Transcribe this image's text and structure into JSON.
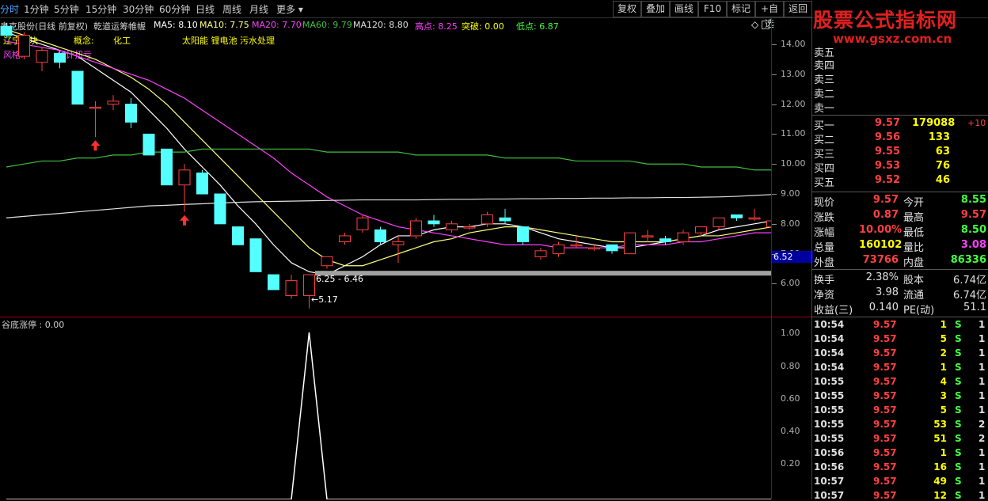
{
  "toolbar": {
    "periods": [
      "分时",
      "1分钟",
      "5分钟",
      "15分钟",
      "30分钟",
      "60分钟",
      "日线",
      "周线",
      "月线",
      "更多"
    ],
    "active_period": "分时",
    "right_buttons": [
      "复权",
      "叠加",
      "画线",
      "F10",
      "标记",
      "+自选",
      "返回"
    ]
  },
  "watermark": {
    "title": "股票公式指标网",
    "url": "www.gsxz.com.cn"
  },
  "chart_header": {
    "stock": "奥克股份(日线 前复权)",
    "indicator": "乾道运筹帷幄",
    "ma5": "MA5: 8.10",
    "ma10": "MA10: 7.75",
    "ma20": "MA20: 7.70",
    "ma60": "MA60: 9.79",
    "ma120": "MA120: 8.80",
    "high": "高点: 8.25",
    "breakout": "突破: 0.00",
    "low": "低点: 6.87"
  },
  "tags": {
    "region": "辽宁板块",
    "concept_label": "概念:",
    "concept_value": "化工",
    "themes": "太阳能 锂电池 污水处理",
    "style_label": "风格:",
    "style_value": "预计扭亏"
  },
  "price_axis": [
    "14.00",
    "13.00",
    "12.00",
    "11.00",
    "10.00",
    "9.00",
    "8.00",
    "7.00",
    "6.00"
  ],
  "current_price_tag": "6.52",
  "annotations": {
    "range": "6.25 - 6.46",
    "low_mark": "5.17"
  },
  "sub_chart": {
    "title": "谷底涨停 : 0.00",
    "axis": [
      "1.00",
      "0.80",
      "0.60",
      "0.40",
      "0.20"
    ]
  },
  "chart_data": {
    "type": "candlestick",
    "candles": [
      {
        "o": 14.6,
        "c": 14.3,
        "h": 14.7,
        "l": 14.2
      },
      {
        "o": 13.6,
        "c": 14.3,
        "h": 14.4,
        "l": 13.5
      },
      {
        "o": 13.4,
        "c": 13.8,
        "h": 13.9,
        "l": 13.1
      },
      {
        "o": 13.7,
        "c": 13.4,
        "h": 13.8,
        "l": 13.2
      },
      {
        "o": 13.1,
        "c": 12.0,
        "h": 13.1,
        "l": 12.0
      },
      {
        "o": 11.9,
        "c": 11.9,
        "h": 12.1,
        "l": 10.9
      },
      {
        "o": 12.0,
        "c": 12.1,
        "h": 12.3,
        "l": 11.8
      },
      {
        "o": 12.0,
        "c": 11.4,
        "h": 12.2,
        "l": 11.2
      },
      {
        "o": 11.0,
        "c": 10.3,
        "h": 11.0,
        "l": 10.3
      },
      {
        "o": 10.5,
        "c": 9.3,
        "h": 10.5,
        "l": 9.3
      },
      {
        "o": 9.3,
        "c": 9.8,
        "h": 10.0,
        "l": 8.4
      },
      {
        "o": 9.7,
        "c": 9.0,
        "h": 9.8,
        "l": 9.0
      },
      {
        "o": 9.0,
        "c": 8.0,
        "h": 9.0,
        "l": 8.0
      },
      {
        "o": 7.9,
        "c": 7.3,
        "h": 7.9,
        "l": 7.3
      },
      {
        "o": 7.5,
        "c": 6.4,
        "h": 7.5,
        "l": 6.4
      },
      {
        "o": 6.3,
        "c": 5.8,
        "h": 6.3,
        "l": 5.8
      },
      {
        "o": 5.6,
        "c": 6.1,
        "h": 6.3,
        "l": 5.5
      },
      {
        "o": 5.6,
        "c": 6.3,
        "h": 6.3,
        "l": 5.17
      },
      {
        "o": 6.6,
        "c": 6.9,
        "h": 6.9,
        "l": 6.5
      },
      {
        "o": 7.4,
        "c": 7.6,
        "h": 7.7,
        "l": 7.3
      },
      {
        "o": 7.8,
        "c": 8.2,
        "h": 8.3,
        "l": 7.7
      },
      {
        "o": 7.8,
        "c": 7.4,
        "h": 7.9,
        "l": 7.3
      },
      {
        "o": 7.3,
        "c": 7.4,
        "h": 7.6,
        "l": 6.7
      },
      {
        "o": 7.6,
        "c": 8.1,
        "h": 8.2,
        "l": 7.5
      },
      {
        "o": 8.1,
        "c": 8.0,
        "h": 8.3,
        "l": 7.9
      },
      {
        "o": 7.8,
        "c": 8.0,
        "h": 8.1,
        "l": 7.7
      },
      {
        "o": 7.9,
        "c": 7.9,
        "h": 8.0,
        "l": 7.8
      },
      {
        "o": 8.0,
        "c": 8.3,
        "h": 8.4,
        "l": 7.9
      },
      {
        "o": 8.2,
        "c": 8.1,
        "h": 8.5,
        "l": 8.0
      },
      {
        "o": 7.9,
        "c": 7.4,
        "h": 7.9,
        "l": 7.3
      },
      {
        "o": 6.9,
        "c": 7.1,
        "h": 7.2,
        "l": 6.8
      },
      {
        "o": 7.0,
        "c": 7.3,
        "h": 7.4,
        "l": 6.9
      },
      {
        "o": 7.3,
        "c": 7.3,
        "h": 7.6,
        "l": 7.2
      },
      {
        "o": 7.2,
        "c": 7.2,
        "h": 7.3,
        "l": 7.1
      },
      {
        "o": 7.3,
        "c": 7.1,
        "h": 7.3,
        "l": 7.0
      },
      {
        "o": 7.0,
        "c": 7.7,
        "h": 7.7,
        "l": 7.0
      },
      {
        "o": 7.6,
        "c": 7.6,
        "h": 7.8,
        "l": 7.4
      },
      {
        "o": 7.5,
        "c": 7.4,
        "h": 7.6,
        "l": 7.3
      },
      {
        "o": 7.4,
        "c": 7.7,
        "h": 7.8,
        "l": 7.3
      },
      {
        "o": 7.7,
        "c": 7.9,
        "h": 7.9,
        "l": 7.6
      },
      {
        "o": 7.9,
        "c": 8.2,
        "h": 8.2,
        "l": 7.8
      },
      {
        "o": 8.3,
        "c": 8.2,
        "h": 8.3,
        "l": 8.1
      },
      {
        "o": 8.2,
        "c": 8.2,
        "h": 8.5,
        "l": 8.1
      },
      {
        "o": 7.9,
        "c": 8.1,
        "h": 8.2,
        "l": 7.9
      }
    ],
    "ma_series": [
      {
        "name": "MA5",
        "color": "#ffffff",
        "values": [
          14.4,
          14.2,
          14.0,
          13.8,
          13.6,
          13.2,
          12.8,
          12.4,
          11.8,
          11.2,
          10.5,
          9.9,
          9.3,
          8.6,
          8.0,
          7.3,
          6.7,
          6.4,
          6.3,
          6.6,
          6.9,
          7.3,
          7.6,
          7.6,
          7.8,
          7.9,
          7.9,
          8.0,
          8.0,
          7.9,
          7.7,
          7.5,
          7.4,
          7.3,
          7.2,
          7.2,
          7.3,
          7.4,
          7.5,
          7.6,
          7.8,
          7.9,
          8.0,
          8.1
        ]
      },
      {
        "name": "MA10",
        "color": "#ffff80",
        "values": [
          14.5,
          14.3,
          14.1,
          13.9,
          13.7,
          13.5,
          13.2,
          12.9,
          12.5,
          12.0,
          11.4,
          10.8,
          10.2,
          9.6,
          9.0,
          8.4,
          7.8,
          7.2,
          6.8,
          6.6,
          6.6,
          6.8,
          7.0,
          7.2,
          7.4,
          7.5,
          7.7,
          7.8,
          7.9,
          7.9,
          7.8,
          7.7,
          7.6,
          7.5,
          7.4,
          7.4,
          7.4,
          7.4,
          7.5,
          7.6,
          7.6,
          7.7,
          7.8,
          7.9
        ]
      },
      {
        "name": "MA20",
        "color": "#ff40ff",
        "values": [
          14.1,
          14.0,
          13.9,
          13.8,
          13.6,
          13.4,
          13.2,
          13.0,
          12.8,
          12.5,
          12.2,
          11.8,
          11.4,
          11.0,
          10.6,
          10.2,
          9.7,
          9.3,
          8.9,
          8.6,
          8.3,
          8.1,
          7.9,
          7.8,
          7.7,
          7.6,
          7.5,
          7.4,
          7.3,
          7.3,
          7.3,
          7.2,
          7.2,
          7.2,
          7.2,
          7.3,
          7.3,
          7.3,
          7.4,
          7.4,
          7.5,
          7.6,
          7.7,
          7.7
        ]
      },
      {
        "name": "MA60",
        "color": "#40c040",
        "values": [
          9.9,
          10.0,
          10.1,
          10.1,
          10.2,
          10.2,
          10.3,
          10.3,
          10.4,
          10.4,
          10.4,
          10.5,
          10.5,
          10.5,
          10.5,
          10.5,
          10.5,
          10.5,
          10.4,
          10.4,
          10.4,
          10.4,
          10.4,
          10.3,
          10.3,
          10.3,
          10.3,
          10.3,
          10.2,
          10.2,
          10.2,
          10.2,
          10.1,
          10.1,
          10.1,
          10.1,
          10.0,
          10.0,
          10.0,
          9.9,
          9.9,
          9.9,
          9.8,
          9.8
        ]
      },
      {
        "name": "MA120",
        "color": "#e0e0e0",
        "values": [
          8.2,
          8.25,
          8.3,
          8.35,
          8.4,
          8.45,
          8.5,
          8.55,
          8.6,
          8.62,
          8.65,
          8.67,
          8.7,
          8.72,
          8.74,
          8.75,
          8.76,
          8.77,
          8.78,
          8.79,
          8.8,
          8.8,
          8.8,
          8.8,
          8.81,
          8.82,
          8.82,
          8.83,
          8.83,
          8.84,
          8.84,
          8.85,
          8.85,
          8.86,
          8.86,
          8.87,
          8.87,
          8.88,
          8.88,
          8.89,
          8.9,
          8.92,
          8.95,
          8.98
        ]
      }
    ],
    "ylim": [
      4.9,
      14.9
    ],
    "sub_series": {
      "values": [
        0,
        0,
        0,
        0,
        0,
        0,
        0,
        0,
        0,
        0,
        0,
        0,
        0,
        0,
        0,
        0,
        0,
        1,
        0,
        0,
        0,
        0,
        0,
        0,
        0,
        0,
        0,
        0,
        0,
        0,
        0,
        0,
        0,
        0,
        0,
        0,
        0,
        0,
        0,
        0,
        0,
        0,
        0,
        0
      ],
      "ylim": [
        0,
        1
      ]
    }
  },
  "quote": {
    "sell_labels": [
      "卖五",
      "卖四",
      "卖三",
      "卖二",
      "卖一"
    ],
    "buy": [
      {
        "label": "买一",
        "price": "9.57",
        "vol": "179088",
        "chg": "+10"
      },
      {
        "label": "买二",
        "price": "9.56",
        "vol": "133",
        "chg": ""
      },
      {
        "label": "买三",
        "price": "9.55",
        "vol": "63",
        "chg": ""
      },
      {
        "label": "买四",
        "price": "9.53",
        "vol": "76",
        "chg": ""
      },
      {
        "label": "买五",
        "price": "9.52",
        "vol": "46",
        "chg": ""
      }
    ],
    "stats": [
      {
        "l1": "现价",
        "v1": "9.57",
        "c1": "#ff4040",
        "l2": "今开",
        "v2": "8.55",
        "c2": "#40ff40"
      },
      {
        "l1": "涨跌",
        "v1": "0.87",
        "c1": "#ff4040",
        "l2": "最高",
        "v2": "9.57",
        "c2": "#ff4040"
      },
      {
        "l1": "涨幅",
        "v1": "10.00%",
        "c1": "#ff4040",
        "l2": "最低",
        "v2": "8.50",
        "c2": "#40ff40"
      },
      {
        "l1": "总量",
        "v1": "160102",
        "c1": "#ffff00",
        "l2": "量比",
        "v2": "3.08",
        "c2": "#ff40ff"
      },
      {
        "l1": "外盘",
        "v1": "73766",
        "c1": "#ff4040",
        "l2": "内盘",
        "v2": "86336",
        "c2": "#40ff40"
      }
    ],
    "fundamentals": [
      {
        "l1": "换手",
        "v1": "2.38%",
        "l2": "股本",
        "v2": "6.74亿"
      },
      {
        "l1": "净资",
        "v1": "3.98",
        "l2": "流通",
        "v2": "6.74亿"
      },
      {
        "l1": "收益(三)",
        "v1": "0.140",
        "l2": "PE(动)",
        "v2": "51.1"
      }
    ],
    "ticks": [
      {
        "time": "10:54",
        "price": "9.57",
        "vol": "1",
        "side": "S",
        "n": "1"
      },
      {
        "time": "10:54",
        "price": "9.57",
        "vol": "5",
        "side": "S",
        "n": "1"
      },
      {
        "time": "10:54",
        "price": "9.57",
        "vol": "2",
        "side": "S",
        "n": "1"
      },
      {
        "time": "10:54",
        "price": "9.57",
        "vol": "1",
        "side": "S",
        "n": "1"
      },
      {
        "time": "10:55",
        "price": "9.57",
        "vol": "4",
        "side": "S",
        "n": "1"
      },
      {
        "time": "10:55",
        "price": "9.57",
        "vol": "3",
        "side": "S",
        "n": "1"
      },
      {
        "time": "10:55",
        "price": "9.57",
        "vol": "5",
        "side": "S",
        "n": "1"
      },
      {
        "time": "10:55",
        "price": "9.57",
        "vol": "53",
        "side": "S",
        "n": "2"
      },
      {
        "time": "10:55",
        "price": "9.57",
        "vol": "51",
        "side": "S",
        "n": "2"
      },
      {
        "time": "10:56",
        "price": "9.57",
        "vol": "1",
        "side": "S",
        "n": "1"
      },
      {
        "time": "10:56",
        "price": "9.57",
        "vol": "16",
        "side": "S",
        "n": "1"
      },
      {
        "time": "10:57",
        "price": "9.57",
        "vol": "49",
        "side": "S",
        "n": "1"
      },
      {
        "time": "10:57",
        "price": "9.57",
        "vol": "12",
        "side": "S",
        "n": "1"
      }
    ]
  }
}
